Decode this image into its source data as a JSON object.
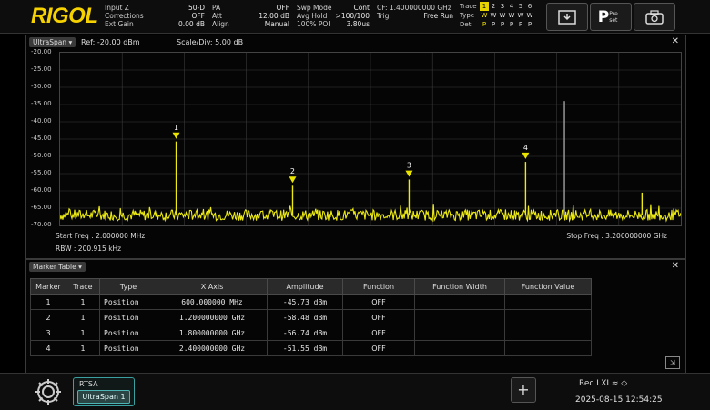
{
  "brand": "RIGOL",
  "status": {
    "col1": [
      {
        "k": "Input Z",
        "v": "50-D"
      },
      {
        "k": "Corrections",
        "v": "OFF"
      },
      {
        "k": "Ext Gain",
        "v": "0.00 dB"
      }
    ],
    "col2": [
      {
        "k": "PA",
        "v": "OFF"
      },
      {
        "k": "Att",
        "v": "12.00 dB"
      },
      {
        "k": "Align",
        "v": "Manual"
      }
    ],
    "col3": [
      {
        "k": "Swp Mode",
        "v": "Cont"
      },
      {
        "k": "Avg Hold",
        "v": ">100/100"
      },
      {
        "k": "100% POI",
        "v": "3.80us"
      }
    ],
    "col4": [
      {
        "k": "CF: 1.400000000 GHz",
        "v": ""
      },
      {
        "k": "Trig:",
        "v": "Free Run"
      }
    ]
  },
  "trace_box": {
    "rows": [
      {
        "label": "Trace",
        "cells": [
          "1",
          "2",
          "3",
          "4",
          "5",
          "6"
        ]
      },
      {
        "label": "Type",
        "cells": [
          "W",
          "W",
          "W",
          "W",
          "W",
          "W"
        ]
      },
      {
        "label": "Det",
        "cells": [
          "P",
          "P",
          "P",
          "P",
          "P",
          "P"
        ]
      }
    ]
  },
  "top_buttons": {
    "preset_label": "Pre set"
  },
  "spectrum": {
    "tab": "UltraSpan",
    "ref": "Ref: -20.00 dBm",
    "scale": "Scale/Div: 5.00 dB",
    "y_ticks": [
      "-20.00",
      "-25.00",
      "-30.00",
      "-35.00",
      "-40.00",
      "-45.00",
      "-50.00",
      "-55.00",
      "-60.00",
      "-65.00",
      "-70.00"
    ],
    "start_freq": "Start Freq : 2.000000 MHz",
    "rbw": "RBW : 200.915 kHz",
    "stop_freq": "Stop Freq : 3.200000000 GHz"
  },
  "markers": [
    {
      "label": "1",
      "freq_ghz": 0.6,
      "amp": -45.73
    },
    {
      "label": "2",
      "freq_ghz": 1.2,
      "amp": -58.48
    },
    {
      "label": "3",
      "freq_ghz": 1.8,
      "amp": -56.74
    },
    {
      "label": "4",
      "freq_ghz": 2.4,
      "amp": -51.55
    }
  ],
  "chart_data": {
    "type": "line",
    "title": "",
    "xlabel": "",
    "ylabel": "",
    "x_range_ghz": [
      0.002,
      3.2
    ],
    "ylim": [
      -70,
      -20
    ],
    "noise_floor_dbm": -67,
    "peaks": [
      {
        "freq_ghz": 0.6,
        "amp": -45.7
      },
      {
        "freq_ghz": 1.2,
        "amp": -58.5
      },
      {
        "freq_ghz": 1.8,
        "amp": -56.7
      },
      {
        "freq_ghz": 2.4,
        "amp": -51.6
      },
      {
        "freq_ghz": 2.6,
        "amp": -34.0
      },
      {
        "freq_ghz": 3.0,
        "amp": -60.5
      }
    ],
    "colors": {
      "trace": "#ecea12",
      "marker": "#e9e300",
      "grid": "#3a3a3a"
    }
  },
  "marker_table": {
    "tab": "Marker Table",
    "headers": [
      "Marker",
      "Trace",
      "Type",
      "X Axis",
      "Amplitude",
      "Function",
      "Function Width",
      "Function Value"
    ],
    "rows": [
      [
        "1",
        "1",
        "Position",
        "600.000000 MHz",
        "-45.73 dBm",
        "OFF",
        "",
        ""
      ],
      [
        "2",
        "1",
        "Position",
        "1.200000000 GHz",
        "-58.48 dBm",
        "OFF",
        "",
        ""
      ],
      [
        "3",
        "1",
        "Position",
        "1.800000000 GHz",
        "-56.74 dBm",
        "OFF",
        "",
        ""
      ],
      [
        "4",
        "1",
        "Position",
        "2.400000000 GHz",
        "-51.55 dBm",
        "OFF",
        "",
        ""
      ]
    ]
  },
  "bottom": {
    "mode": "RTSA",
    "measure": "UltraSpan 1",
    "plus": "+",
    "status_icons": "Rec LXI ≈ ◇",
    "datetime": "2025-08-15 12:54:25"
  }
}
